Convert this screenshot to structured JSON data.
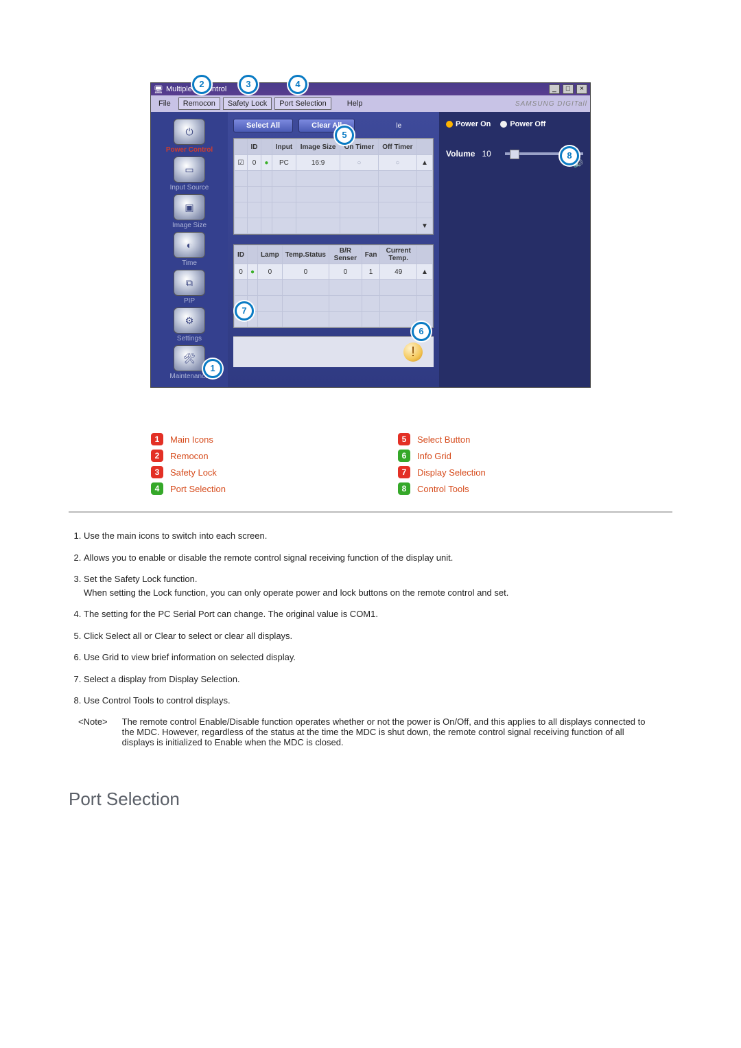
{
  "app": {
    "title_left": "Multiple D",
    "title_right": "Control",
    "menu": {
      "file": "File",
      "remocon": "Remocon",
      "safety_lock": "Safety Lock",
      "port_selection": "Port Selection",
      "help": "Help"
    },
    "brand": "SAMSUNG DIGITall"
  },
  "sidebar": {
    "items": [
      {
        "label": "Power Control",
        "glyph": "⏻",
        "selected": true
      },
      {
        "label": "Input Source",
        "glyph": "▭"
      },
      {
        "label": "Image Size",
        "glyph": "▣"
      },
      {
        "label": "Time",
        "glyph": "◐"
      },
      {
        "label": "PIP",
        "glyph": "⧉"
      },
      {
        "label": "Settings",
        "glyph": "⚙"
      },
      {
        "label": "Maintenance",
        "glyph": "🛠"
      }
    ]
  },
  "top_buttons": {
    "select_all": "Select All",
    "clear_all": "Clear All",
    "le_suffix": "le"
  },
  "info_grid": {
    "headers": [
      "",
      "ID",
      "",
      "Input",
      "Image Size",
      "On Timer",
      "Off Timer",
      ""
    ],
    "row": {
      "id": "0",
      "status": "●",
      "input": "PC",
      "image_size": "16:9",
      "on_timer": "○",
      "off_timer": "○"
    },
    "blank_rows": 4
  },
  "display_grid": {
    "headers": [
      "ID",
      "",
      "Lamp",
      "Temp.Status",
      "B/R Senser",
      "Fan",
      "Current Temp.",
      ""
    ],
    "row": {
      "id": "0",
      "status": "●",
      "lamp": "0",
      "temp_status": "0",
      "br": "0",
      "fan": "1",
      "cur_temp": "49"
    },
    "blank_rows": 3
  },
  "control_tools": {
    "power_on": "Power On",
    "power_off": "Power Off",
    "volume_label": "Volume",
    "volume_value": "10"
  },
  "callouts": {
    "c1": "1",
    "c2": "2",
    "c3": "3",
    "c4": "4",
    "c5": "5",
    "c6": "6",
    "c7": "7",
    "c8": "8"
  },
  "legend": {
    "left": [
      {
        "n": "1",
        "label": "Main Icons"
      },
      {
        "n": "2",
        "label": "Remocon"
      },
      {
        "n": "3",
        "label": "Safety Lock"
      },
      {
        "n": "4",
        "label": "Port Selection"
      }
    ],
    "right": [
      {
        "n": "5",
        "label": "Select Button"
      },
      {
        "n": "6",
        "label": "Info Grid"
      },
      {
        "n": "7",
        "label": "Display Selection"
      },
      {
        "n": "8",
        "label": "Control Tools"
      }
    ]
  },
  "notes": {
    "items": [
      "Use the main icons to switch into each screen.",
      "Allows you to enable or disable the remote control signal receiving function of the display unit.",
      "Set the Safety Lock function.\nWhen setting the Lock function, you can only operate power and lock buttons on the remote control and set.",
      "The setting for the PC Serial Port can change. The original value is COM1.",
      "Click Select all or Clear to select or clear all displays.",
      "Use Grid to view brief information on selected display.",
      "Select a display from Display Selection.",
      "Use Control Tools to control displays."
    ],
    "note_label": "<Note>",
    "note_text": "The remote control Enable/Disable function operates whether or not the power is On/Off, and this applies to all displays connected to the MDC. However, regardless of the status at the time the MDC is shut down, the remote control signal receiving function of all displays is initialized to Enable when the MDC is closed."
  },
  "section_title": "Port Selection"
}
